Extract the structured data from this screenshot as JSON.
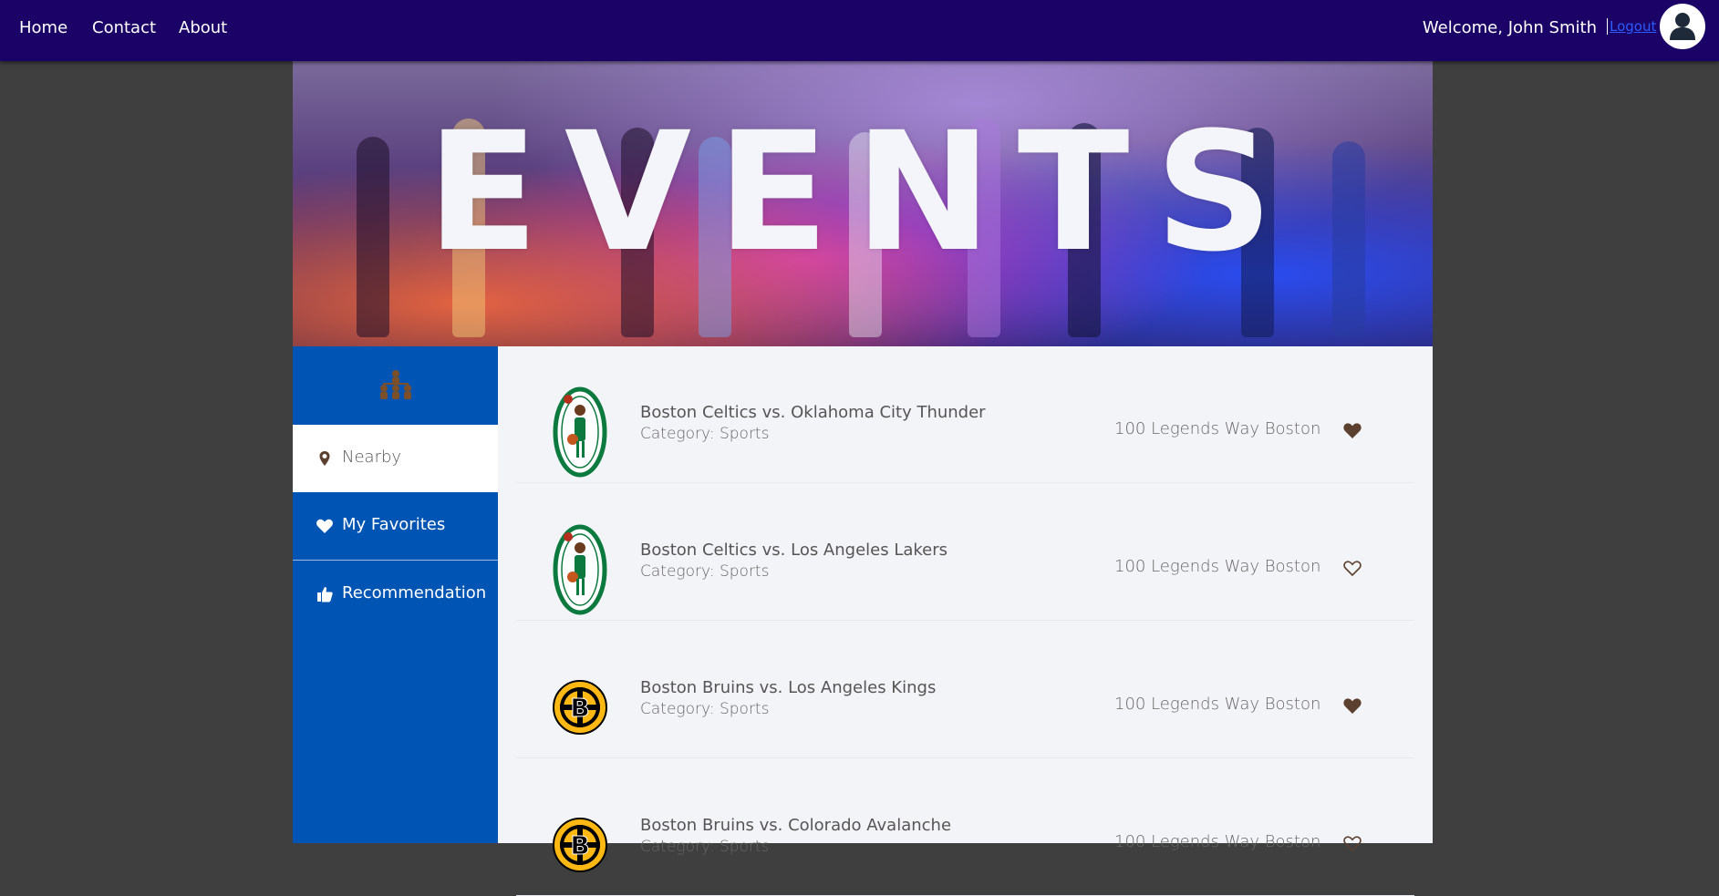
{
  "nav": {
    "links": [
      "Home",
      "Contact",
      "About"
    ],
    "welcome": "Welcome, John Smith",
    "logout": "Logout"
  },
  "hero": {
    "title": "EVENTS"
  },
  "sidebar": {
    "items": [
      {
        "label": "Nearby",
        "icon": "map-pin-icon",
        "active": true
      },
      {
        "label": "My Favorites",
        "icon": "heart-icon",
        "active": false
      },
      {
        "label": "Recommendation",
        "icon": "thumbs-up-icon",
        "active": false
      }
    ]
  },
  "events": [
    {
      "title": "Boston Celtics vs. Oklahoma City Thunder",
      "category": "Category: Sports",
      "address": "100 Legends Way Boston",
      "logo": "celtics-logo",
      "favorite": true
    },
    {
      "title": "Boston Celtics vs. Los Angeles Lakers",
      "category": "Category: Sports",
      "address": "100 Legends Way Boston",
      "logo": "celtics-logo",
      "favorite": false
    },
    {
      "title": "Boston Bruins vs. Los Angeles Kings",
      "category": "Category: Sports",
      "address": "100 Legends Way Boston",
      "logo": "bruins-logo",
      "favorite": true
    },
    {
      "title": "Boston Bruins vs. Colorado Avalanche",
      "category": "Category: Sports",
      "address": "100 Legends Way Boston",
      "logo": "bruins-logo",
      "favorite": false
    }
  ],
  "colors": {
    "topbar": "#1b0266",
    "sidebar": "#0054b3",
    "heart": "#5b4030",
    "logout": "#2c5cff"
  }
}
